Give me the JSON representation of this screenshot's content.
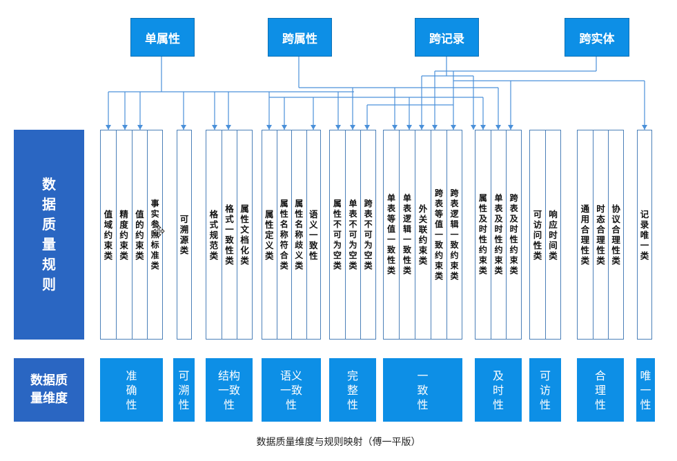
{
  "top_categories": [
    "单属性",
    "跨属性",
    "跨记录",
    "跨实体"
  ],
  "rules_title": "数据质量规则",
  "dimensions_title": "数据质量维度",
  "rule_groups": [
    {
      "rules": [
        "值域约束类",
        "精度约束类",
        "值的约束类",
        "事实参照标准类"
      ]
    },
    {
      "rules": [
        "可溯源类"
      ]
    },
    {
      "rules": [
        "格式规范类",
        "格式一致性类",
        "属性文档化类"
      ]
    },
    {
      "rules": [
        "属性定义类",
        "属性名称符合类",
        "属性名称歧义类",
        "语义一致性"
      ]
    },
    {
      "rules": [
        "属性不可为空类",
        "单表不可为空类",
        "跨表不可为空类"
      ]
    },
    {
      "rules": [
        "单表等值一致性类",
        "单表逻辑一致性类",
        "外关联约束类",
        "跨表等值一致约束类",
        "跨表逻辑一致约束类"
      ]
    },
    {
      "rules": [
        "属性及时性约束类",
        "单表及时性约束类",
        "跨表及时性约束类"
      ]
    },
    {
      "rules": [
        "可访问性类",
        "响应时间类"
      ]
    },
    {
      "rules": [
        "通用合理性类",
        "时态合理性类",
        "协议合理性类"
      ]
    },
    {
      "rules": [
        "记录唯一类"
      ]
    }
  ],
  "dimensions": [
    "准确性",
    "可溯性",
    "结构一致性",
    "语义一致性",
    "完整性",
    "一致性",
    "及时性",
    "可访性",
    "合理性",
    "唯一性"
  ],
  "caption": "数据质量维度与规则映射（傅一平版）",
  "colors": {
    "box_blue": "#0d8fe6",
    "left_blue": "#2a66c2",
    "line_blue": "#4a90d9"
  }
}
